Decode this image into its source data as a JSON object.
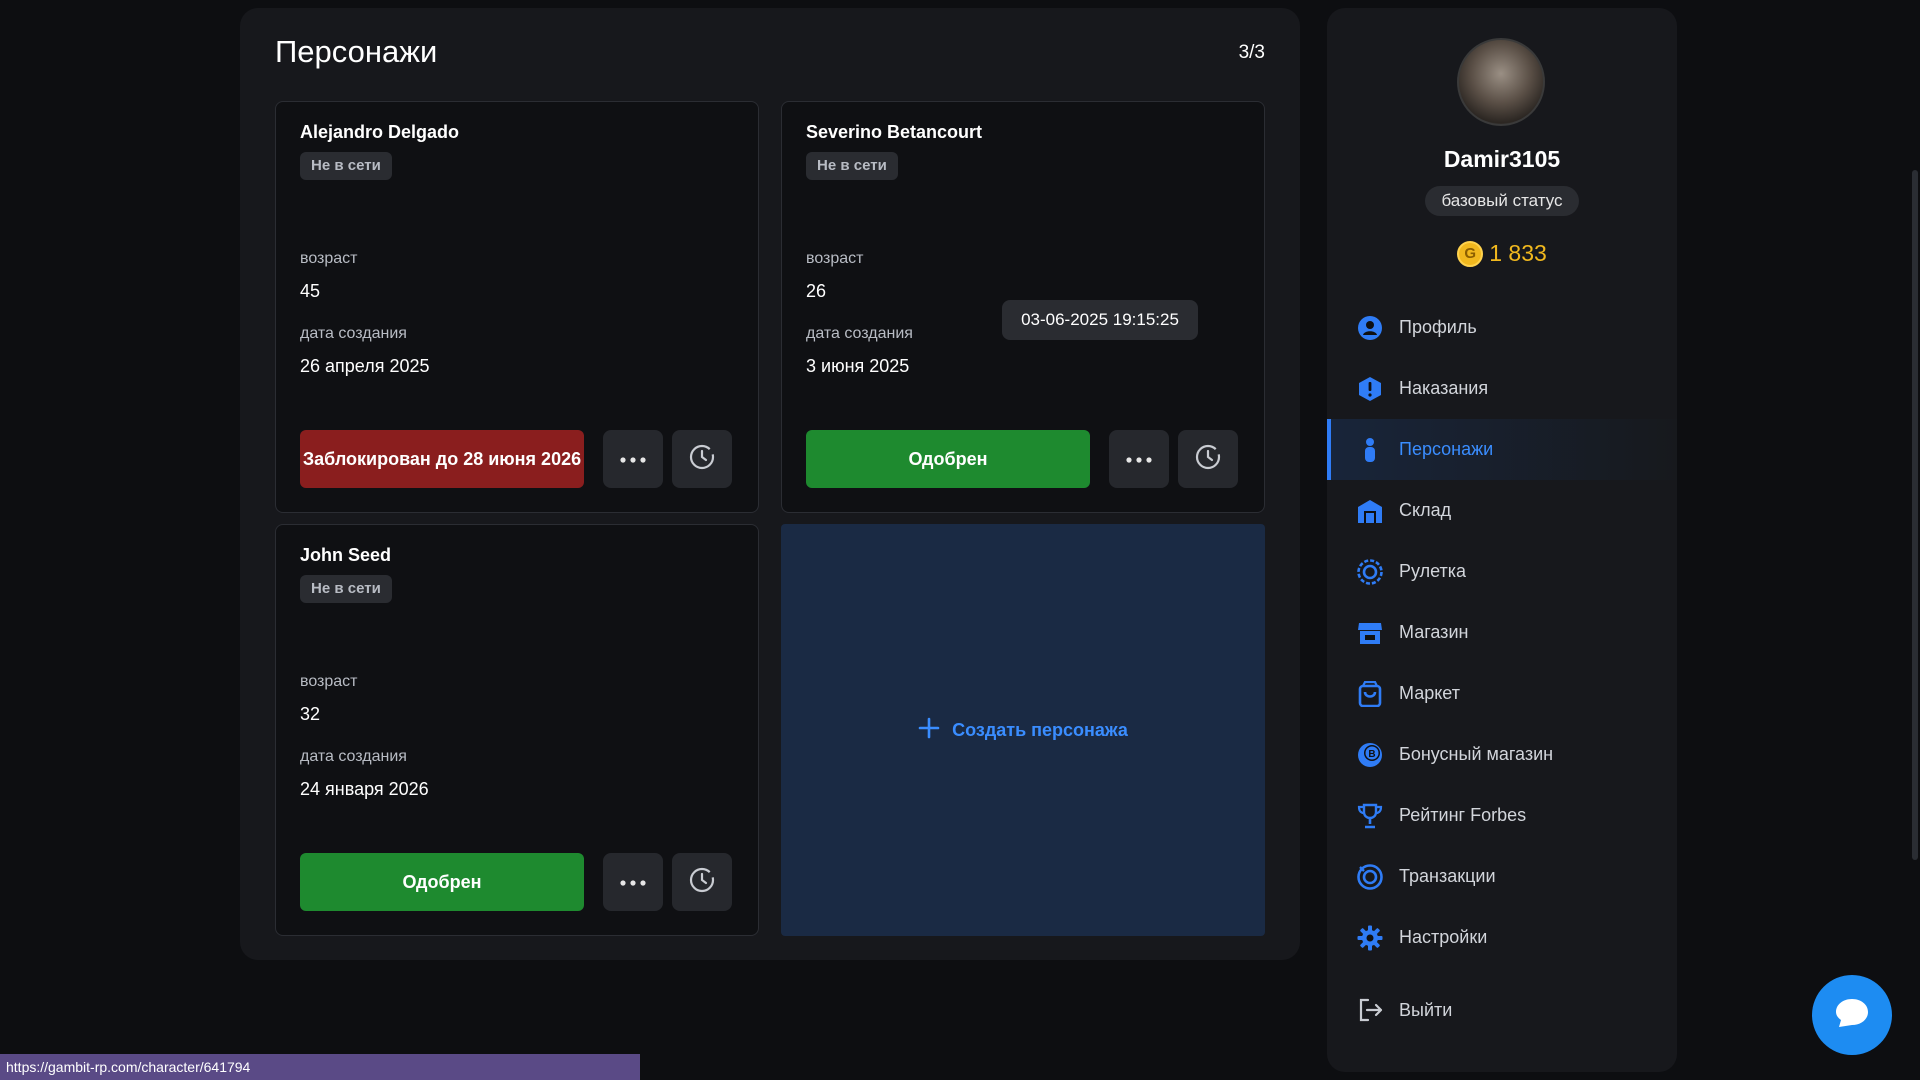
{
  "main": {
    "title": "Персонажи",
    "count": "3/3",
    "characters": [
      {
        "name": "Alejandro Delgado",
        "status": "Не в сети",
        "age_label": "возраст",
        "age": "45",
        "created_label": "дата создания",
        "created": "26 апреля 2025",
        "action_label": "Заблокирован до 28 июня 2026",
        "action_color": "#8a1e1e"
      },
      {
        "name": "Severino Betancourt",
        "status": "Не в сети",
        "age_label": "возраст",
        "age": "26",
        "created_label": "дата создания",
        "created": "3 июня 2025",
        "action_label": "Одобрен",
        "action_color": "#1e8a2f"
      },
      {
        "name": "John Seed",
        "status": "Не в сети",
        "age_label": "возраст",
        "age": "32",
        "created_label": "дата создания",
        "created": "24 января 2026",
        "action_label": "Одобрен",
        "action_color": "#1e8a2f"
      }
    ],
    "create_label": "Создать персонажа",
    "tooltip": "03-06-2025 19:15:25"
  },
  "sidebar": {
    "username": "Damir3105",
    "status": "базовый статус",
    "coin_symbol": "G",
    "balance": "1 833",
    "items": [
      {
        "label": "Профиль",
        "icon": "user-icon"
      },
      {
        "label": "Наказания",
        "icon": "warning-icon"
      },
      {
        "label": "Персонажи",
        "icon": "person-icon",
        "active": true
      },
      {
        "label": "Склад",
        "icon": "warehouse-icon"
      },
      {
        "label": "Рулетка",
        "icon": "roulette-icon"
      },
      {
        "label": "Магазин",
        "icon": "store-icon"
      },
      {
        "label": "Маркет",
        "icon": "bag-icon"
      },
      {
        "label": "Бонусный магазин",
        "icon": "bonus-icon"
      },
      {
        "label": "Рейтинг Forbes",
        "icon": "trophy-icon"
      },
      {
        "label": "Транзакции",
        "icon": "transactions-icon"
      },
      {
        "label": "Настройки",
        "icon": "gear-icon"
      }
    ],
    "logout": "Выйти"
  },
  "status_bar": {
    "url": "https://gambit-rp.com/character/641794"
  },
  "colors": {
    "accent": "#3a8dff",
    "approved": "#1e8a2f",
    "blocked": "#8a1e1e",
    "coin": "#f1b81e"
  }
}
